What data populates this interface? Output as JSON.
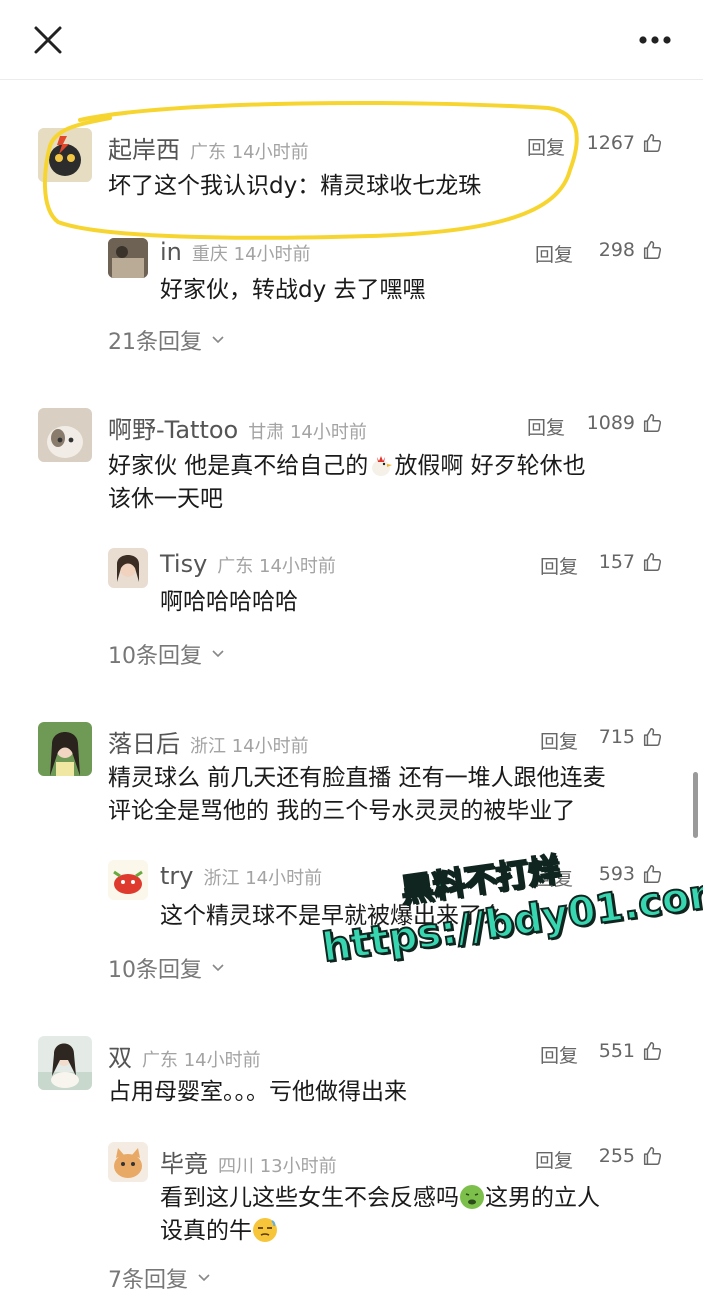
{
  "header": {
    "close_icon": "close-icon",
    "more_icon": "more-dots-icon"
  },
  "comments": [
    {
      "name": "起岸西",
      "location": "广东",
      "time": "14小时前",
      "reply_label": "回复",
      "likes": "1267",
      "text": "坏了这个我认识dy：精灵球收七龙珠",
      "sub_reply": {
        "name": "in",
        "location": "重庆",
        "time": "14小时前",
        "reply_label": "回复",
        "likes": "298",
        "text": "好家伙，转战dy 去了嘿嘿"
      },
      "more_replies": "21条回复"
    },
    {
      "name": "啊野-Tattoo",
      "location": "甘肃",
      "time": "14小时前",
      "reply_label": "回复",
      "likes": "1089",
      "text_line1_pre": "好家伙 他是真不给自己的",
      "text_line1_post": "放假啊 好歹轮休也",
      "text_line2": "该休一天吧",
      "emoji_icon": "rooster-emoji",
      "sub_reply": {
        "name": "Tisy",
        "location": "广东",
        "time": "14小时前",
        "reply_label": "回复",
        "likes": "157",
        "text": "啊哈哈哈哈哈"
      },
      "more_replies": "10条回复"
    },
    {
      "name": "落日后",
      "location": "浙江",
      "time": "14小时前",
      "reply_label": "回复",
      "likes": "715",
      "text_line1": "精灵球么 前几天还有脸直播 还有一堆人跟他连麦",
      "text_line2": "评论全是骂他的 我的三个号水灵灵的被毕业了",
      "sub_reply": {
        "name": "try",
        "location": "浙江",
        "time": "14小时前",
        "reply_label": "回复",
        "likes": "593",
        "text": "这个精灵球不是早就被爆出来了么"
      },
      "more_replies": "10条回复"
    },
    {
      "name": "双",
      "location": "广东",
      "time": "14小时前",
      "reply_label": "回复",
      "likes": "551",
      "text": "占用母婴室。。。亏他做得出来",
      "sub_reply": {
        "name": "毕竟",
        "location": "四川",
        "time": "13小时前",
        "reply_label": "回复",
        "likes": "255",
        "text_line1_pre": "看到这儿这些女生不会反感吗",
        "text_line1_post": "这男的立人",
        "text_line2_pre": "设真的牛",
        "emoji1_icon": "nauseated-face-emoji",
        "emoji2_icon": "unamused-face-emoji"
      },
      "more_replies": "7条回复"
    }
  ],
  "watermark": {
    "line1": "黑料不打烊",
    "line2": "https://bdy01.com"
  },
  "colors": {
    "highlight": "#f7d531",
    "watermark_fill": "#38d6b0",
    "text": "#1a1a1a",
    "meta": "#a3a3a3"
  }
}
